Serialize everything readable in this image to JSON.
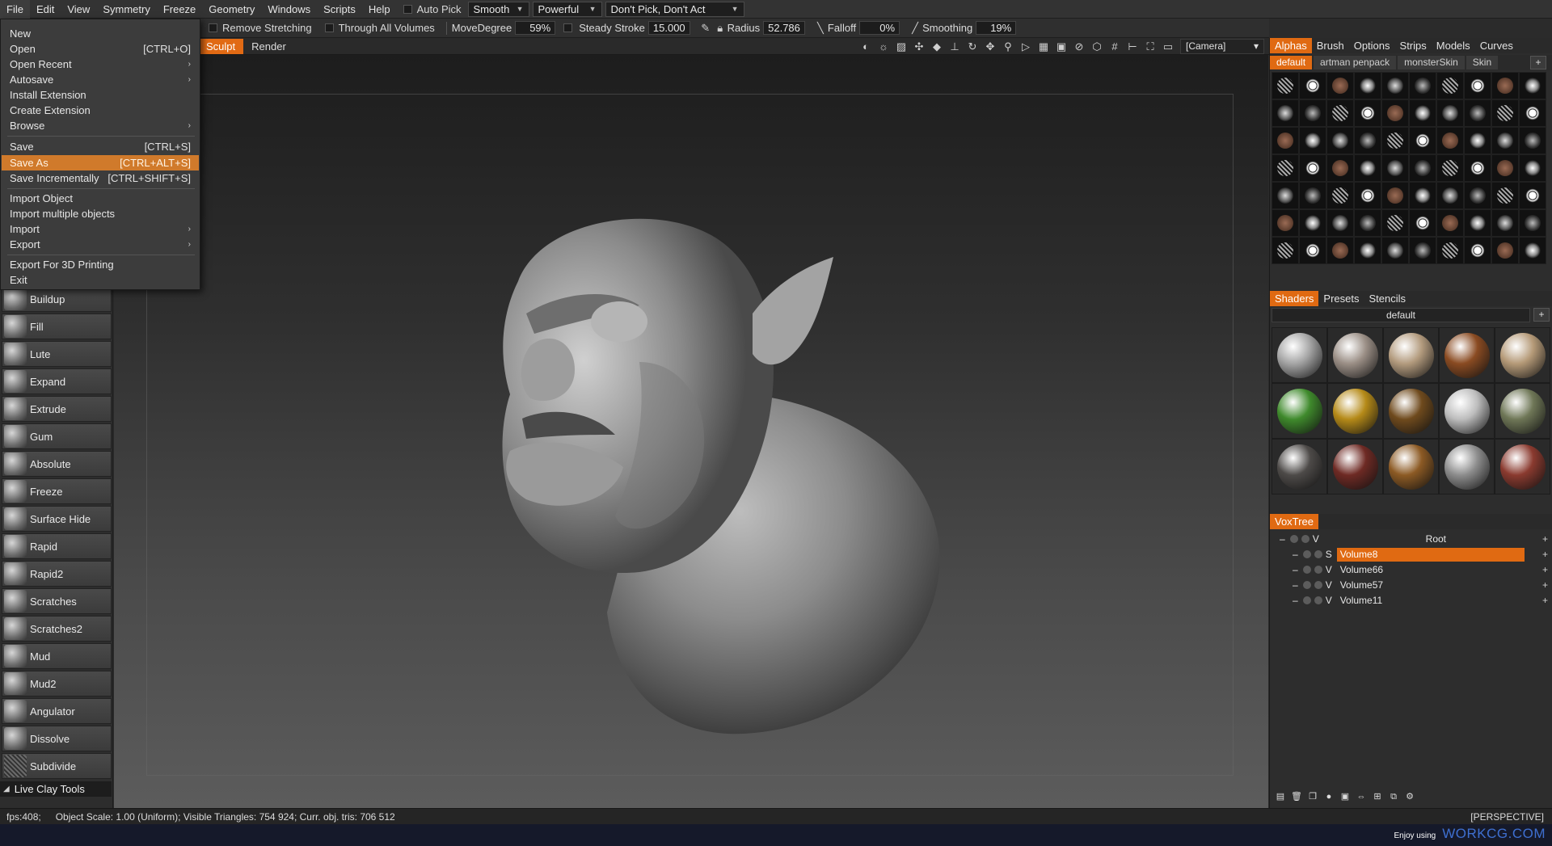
{
  "menubar": {
    "items": [
      "File",
      "Edit",
      "View",
      "Symmetry",
      "Freeze",
      "Geometry",
      "Windows",
      "Scripts",
      "Help"
    ],
    "auto_pick": "Auto Pick",
    "mode_dd": "Smooth",
    "power_dd": "Powerful",
    "pick_dd": "Don't Pick, Don't Act"
  },
  "options": {
    "remove_stretching": "Remove Stretching",
    "through_all_volumes": "Through All Volumes",
    "move_degree_label": "MoveDegree",
    "move_degree_value": "59%",
    "steady_stroke_label": "Steady Stroke",
    "steady_stroke_value": "15.000",
    "radius_label": "Radius",
    "radius_value": "52.786",
    "falloff_label": "Falloff",
    "falloff_value": "0%",
    "smoothing_label": "Smoothing",
    "smoothing_value": "19%"
  },
  "modes": {
    "sculpt": "Sculpt",
    "render": "Render",
    "camera": "[Camera]"
  },
  "file_menu": {
    "new": "New",
    "open": "Open",
    "open_sc": "[CTRL+O]",
    "open_recent": "Open Recent",
    "autosave": "Autosave",
    "install_extension": "Install Extension",
    "create_extension": "Create Extension",
    "browse": "Browse",
    "save": "Save",
    "save_sc": "[CTRL+S]",
    "save_as": "Save As",
    "save_as_sc": "[CTRL+ALT+S]",
    "save_incrementally": "Save Incrementally",
    "save_incrementally_sc": "[CTRL+SHIFT+S]",
    "import_object": "Import Object",
    "import_multiple": "Import multiple objects",
    "import": "Import",
    "export": "Export",
    "export_3d": "Export For 3D Printing",
    "exit": "Exit"
  },
  "tools": {
    "items": [
      "Buildup",
      "Fill",
      "Lute",
      "Expand",
      "Extrude",
      "Gum",
      "Absolute",
      "Freeze",
      "Surface Hide",
      "Rapid",
      "Rapid2",
      "Scratches",
      "Scratches2",
      "Mud",
      "Mud2",
      "Angulator",
      "Dissolve",
      "Subdivide"
    ],
    "group": "Live Clay Tools"
  },
  "status": {
    "fps": "fps:408;",
    "info": "Object Scale: 1.00 (Uniform); Visible Triangles: 754 924; Curr. obj. tris: 706 512",
    "projection": "[PERSPECTIVE]",
    "watermark_small": "Enjoy using",
    "watermark_big": "WORKCG.COM"
  },
  "right": {
    "top_tabs": [
      "Alphas",
      "Brush",
      "Options",
      "Strips",
      "Models",
      "Curves"
    ],
    "alpha_subtabs": [
      "default",
      "artman penpack",
      "monsterSkin",
      "Skin"
    ],
    "shader_tabs": [
      "Shaders",
      "Presets",
      "Stencils"
    ],
    "shader_preset": "default",
    "voxtree_tab": "VoxTree",
    "voxtree": [
      {
        "flag": "V",
        "name": "Root"
      },
      {
        "flag": "S",
        "name": "Volume8"
      },
      {
        "flag": "V",
        "name": "Volume66"
      },
      {
        "flag": "V",
        "name": "Volume57"
      },
      {
        "flag": "V",
        "name": "Volume11"
      }
    ]
  },
  "colors": {
    "accent": "#e06a12",
    "menu_highlight": "#d07a2b",
    "watermark": "#3e6fd0"
  }
}
